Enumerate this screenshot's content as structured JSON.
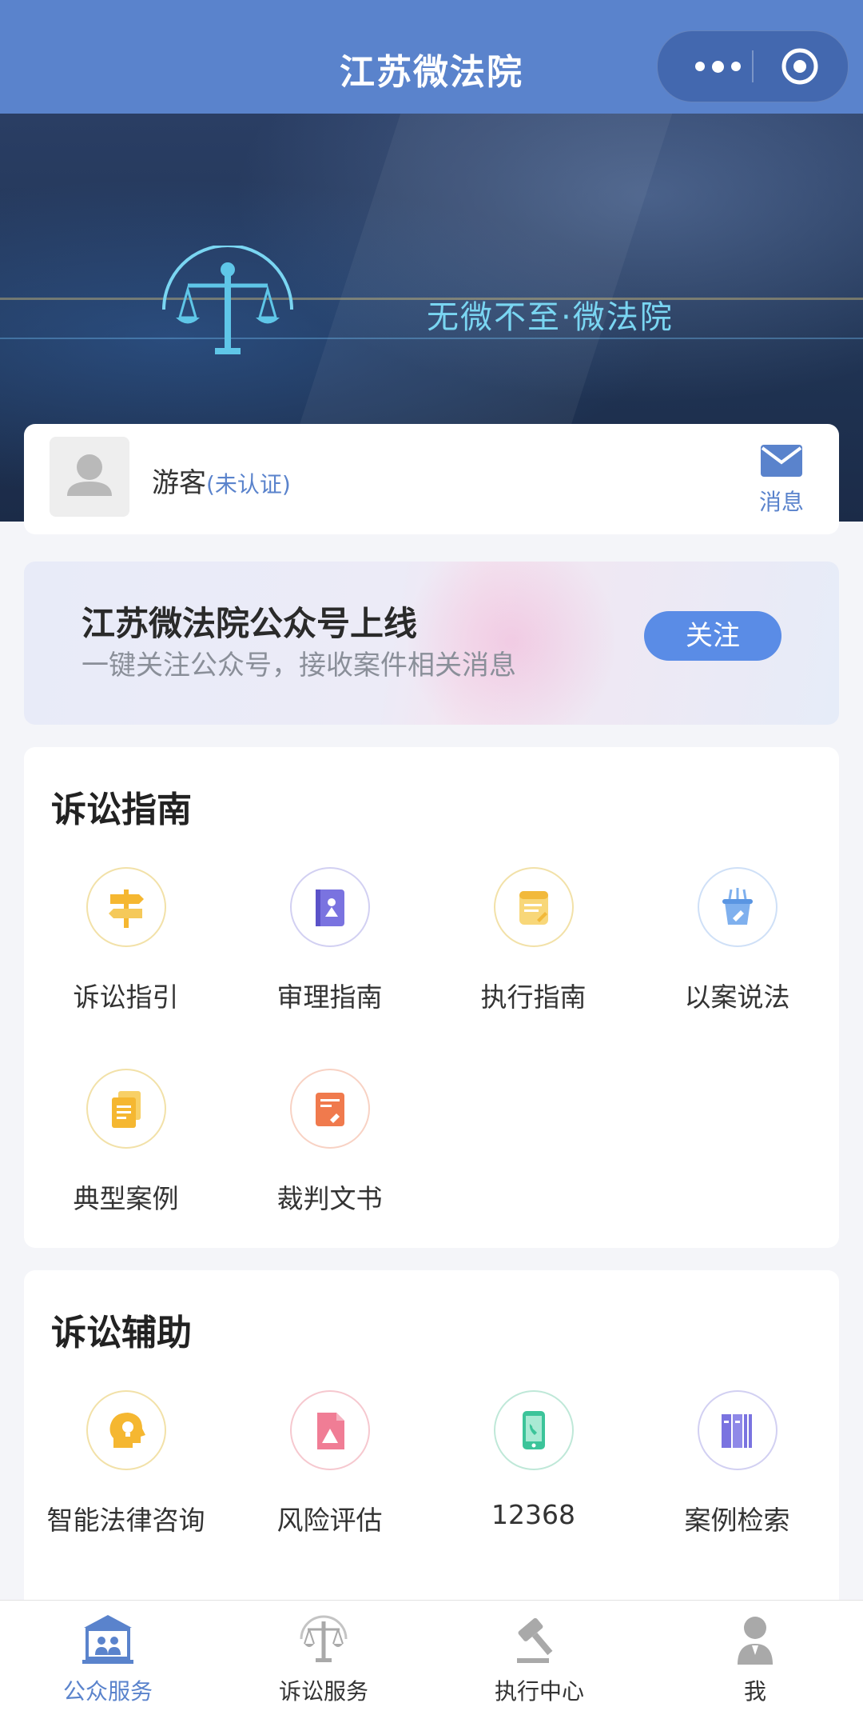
{
  "navbar": {
    "title": "江苏微法院"
  },
  "banner": {
    "slogan": "无微不至·微法院"
  },
  "user": {
    "name": "游客",
    "status": "(未认证)",
    "message_label": "消息"
  },
  "promo": {
    "title": "江苏微法院公众号上线",
    "subtitle": "一键关注公众号，接收案件相关消息",
    "button": "关注"
  },
  "guide": {
    "title": "诉讼指南",
    "items": [
      {
        "label": "诉讼指引",
        "icon": "signpost-icon"
      },
      {
        "label": "审理指南",
        "icon": "book-icon"
      },
      {
        "label": "执行指南",
        "icon": "notepad-icon"
      },
      {
        "label": "以案说法",
        "icon": "gavel-basket-icon"
      },
      {
        "label": "典型案例",
        "icon": "documents-icon"
      },
      {
        "label": "裁判文书",
        "icon": "judgment-doc-icon"
      }
    ]
  },
  "assist": {
    "title": "诉讼辅助",
    "items": [
      {
        "label": "智能法律咨询",
        "icon": "head-lightbulb-icon"
      },
      {
        "label": "风险评估",
        "icon": "risk-doc-icon"
      },
      {
        "label": "12368",
        "icon": "phone-icon"
      },
      {
        "label": "案例检索",
        "icon": "books-icon"
      }
    ]
  },
  "tabs": [
    {
      "label": "公众服务",
      "active": true
    },
    {
      "label": "诉讼服务",
      "active": false
    },
    {
      "label": "执行中心",
      "active": false
    },
    {
      "label": "我",
      "active": false
    }
  ],
  "colors": {
    "primary": "#5a83cc",
    "button": "#5a8ce6"
  }
}
